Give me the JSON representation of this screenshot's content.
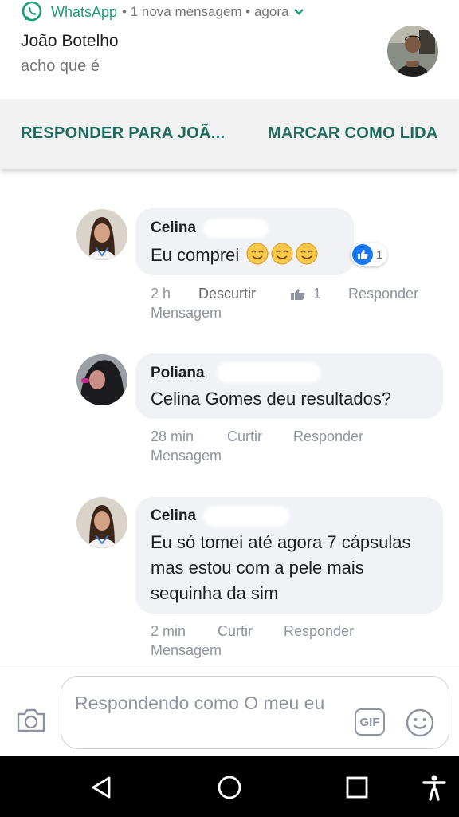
{
  "notification": {
    "app_name": "WhatsApp",
    "meta": "• 1 nova mensagem • agora",
    "sender": "João Botelho",
    "message": "acho que é",
    "actions": {
      "reply": "RESPONDER PARA JOÃ...",
      "mark_read": "MARCAR COMO LIDA"
    }
  },
  "comments": [
    {
      "author": "Celina",
      "text": "Eu comprei",
      "emojis": [
        "smiling-face",
        "smiling-face",
        "smiling-face"
      ],
      "reaction_count": "1",
      "time": "2 h",
      "like_action": "Descurtir",
      "likes": "1",
      "reply": "Responder",
      "message": "Mensagem"
    },
    {
      "author": "Poliana",
      "text": "Celina Gomes deu resultados?",
      "time": "28 min",
      "like_action": "Curtir",
      "reply": "Responder",
      "message": "Mensagem"
    },
    {
      "author": "Celina",
      "text": "Eu só tomei até agora 7 cápsulas mas estou com a pele mais sequinha da sim",
      "time": "2 min",
      "like_action": "Curtir",
      "reply": "Responder",
      "message": "Mensagem"
    }
  ],
  "composer": {
    "placeholder": "Respondendo como O meu eu",
    "gif_label": "GIF"
  },
  "icons": {
    "camera": "camera-icon",
    "smiley": "smiley-icon",
    "back": "back-icon",
    "home": "home-icon",
    "recents": "recents-icon",
    "accessibility": "accessibility-icon"
  },
  "colors": {
    "whatsapp_green": "#1a9e78",
    "action_green": "#1a6b5c",
    "facebook_blue": "#1877f2",
    "bubble_gray": "#f0f2f5"
  }
}
